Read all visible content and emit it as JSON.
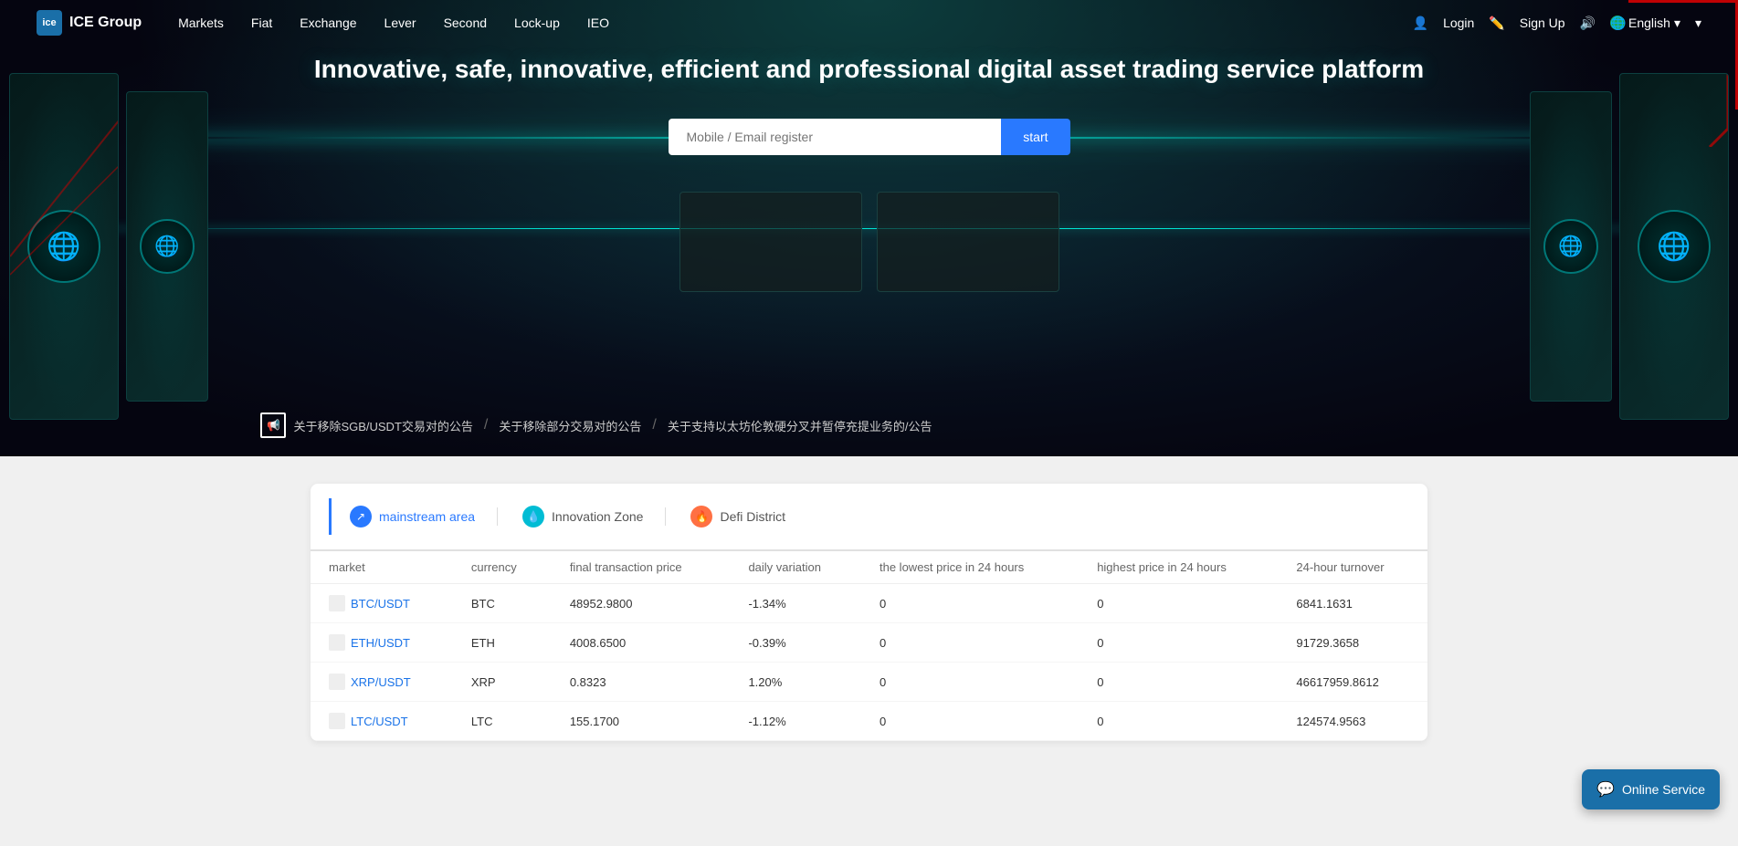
{
  "navbar": {
    "logo_text": "ICE Group",
    "logo_abbr": "ice",
    "nav_items": [
      {
        "label": "Markets",
        "href": "#"
      },
      {
        "label": "Fiat",
        "href": "#"
      },
      {
        "label": "Exchange",
        "href": "#"
      },
      {
        "label": "Lever",
        "href": "#"
      },
      {
        "label": "Second",
        "href": "#"
      },
      {
        "label": "Lock-up",
        "href": "#"
      },
      {
        "label": "IEO",
        "href": "#"
      }
    ],
    "login_label": "Login",
    "signup_label": "Sign Up",
    "language": "English"
  },
  "hero": {
    "title": "Innovative, safe, innovative, efficient and professional digital asset trading service platform",
    "search_placeholder": "Mobile / Email register",
    "search_btn": "start",
    "announcements": [
      "关于移除SGB/USDT交易对的公告",
      "关于移除部分交易对的公告",
      "关于支持以太坊伦敦硬分叉并暂停充提业务的/公告"
    ]
  },
  "market": {
    "tabs": [
      {
        "label": "mainstream area",
        "icon": "↗",
        "active": true
      },
      {
        "label": "Innovation Zone",
        "icon": "💧",
        "active": false
      },
      {
        "label": "Defi District",
        "icon": "🔥",
        "active": false
      }
    ],
    "columns": [
      "market",
      "currency",
      "final transaction price",
      "daily variation",
      "the lowest price in 24 hours",
      "highest price in 24 hours",
      "24-hour turnover"
    ],
    "rows": [
      {
        "pair": "BTC/USDT",
        "currency": "BTC",
        "price": "48952.9800",
        "change": "-1.34%",
        "low": "0",
        "high": "0",
        "turnover": "6841.1631",
        "change_type": "negative"
      },
      {
        "pair": "ETH/USDT",
        "currency": "ETH",
        "price": "4008.6500",
        "change": "-0.39%",
        "low": "0",
        "high": "0",
        "turnover": "91729.3658",
        "change_type": "negative"
      },
      {
        "pair": "XRP/USDT",
        "currency": "XRP",
        "price": "0.8323",
        "change": "1.20%",
        "low": "0",
        "high": "0",
        "turnover": "46617959.8612",
        "change_type": "positive"
      },
      {
        "pair": "LTC/USDT",
        "currency": "LTC",
        "price": "155.1700",
        "change": "-1.12%",
        "low": "0",
        "high": "0",
        "turnover": "124574.9563",
        "change_type": "negative"
      }
    ]
  },
  "online_service": {
    "label": "Online Service",
    "chat_icon": "💬"
  }
}
